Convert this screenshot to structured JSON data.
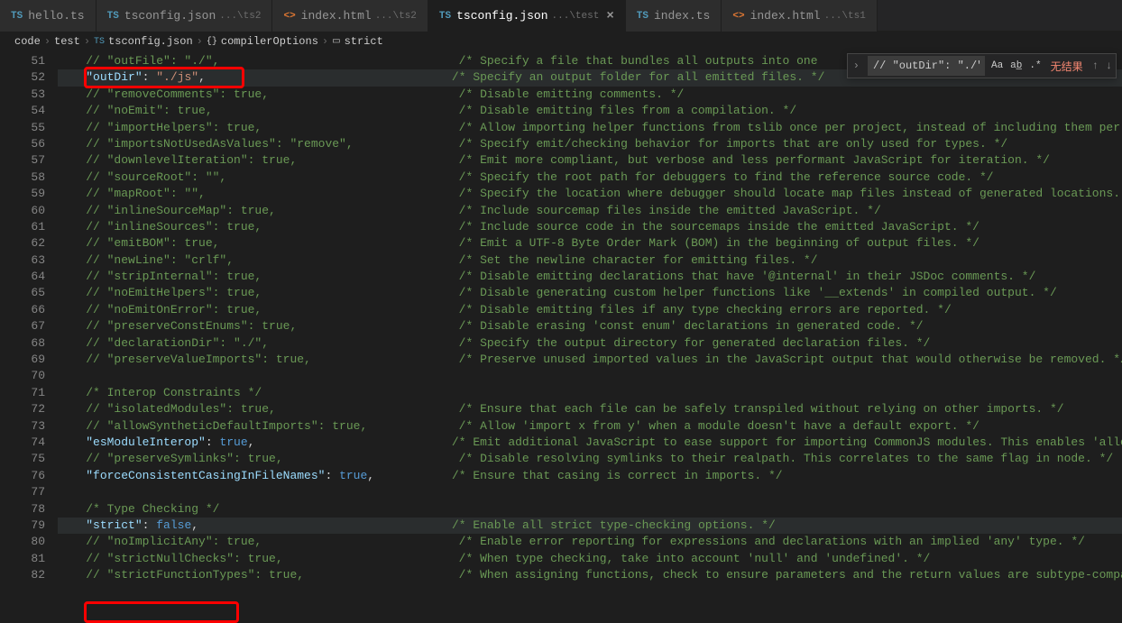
{
  "tabs": [
    {
      "icon": "TS",
      "label": "hello.ts",
      "path": "",
      "active": false
    },
    {
      "icon": "TS",
      "label": "tsconfig.json",
      "path": "...\\ts2",
      "active": false
    },
    {
      "icon": "<>",
      "label": "index.html",
      "path": "...\\ts2",
      "active": false,
      "html": true
    },
    {
      "icon": "TS",
      "label": "tsconfig.json",
      "path": "...\\test",
      "active": true,
      "close": "×"
    },
    {
      "icon": "TS",
      "label": "index.ts",
      "path": "",
      "active": false
    },
    {
      "icon": "<>",
      "label": "index.html",
      "path": "...\\ts1",
      "active": false,
      "html": true
    }
  ],
  "breadcrumb": {
    "items": [
      "code",
      "test",
      "tsconfig.json",
      "compilerOptions",
      "strict"
    ],
    "sep": "›"
  },
  "find": {
    "toggle": "›",
    "value": "// \"outDir\": \"./\",",
    "btns": {
      "aa": "Aa",
      "ab": "ab̲",
      "re": ".*"
    },
    "result": "无结果",
    "up": "↑",
    "down": "↓"
  },
  "lines": [
    {
      "n": 51,
      "c": "    // \"outFile\": \"./\",                                  /* Specify a file that bundles all outputs into one "
    },
    {
      "n": 52,
      "key": "\"outDir\"",
      "val": "\"./js\"",
      "c2": "/* Specify an output folder for all emitted files. */",
      "hi": true,
      "strval": true
    },
    {
      "n": 53,
      "c": "    // \"removeComments\": true,                           /* Disable emitting comments. */"
    },
    {
      "n": 54,
      "c": "    // \"noEmit\": true,                                   /* Disable emitting files from a compilation. */"
    },
    {
      "n": 55,
      "c": "    // \"importHelpers\": true,                            /* Allow importing helper functions from tslib once per project, instead of including them per-f"
    },
    {
      "n": 56,
      "c": "    // \"importsNotUsedAsValues\": \"remove\",               /* Specify emit/checking behavior for imports that are only used for types. */"
    },
    {
      "n": 57,
      "c": "    // \"downlevelIteration\": true,                       /* Emit more compliant, but verbose and less performant JavaScript for iteration. */"
    },
    {
      "n": 58,
      "c": "    // \"sourceRoot\": \"\",                                 /* Specify the root path for debuggers to find the reference source code. */"
    },
    {
      "n": 59,
      "c": "    // \"mapRoot\": \"\",                                    /* Specify the location where debugger should locate map files instead of generated locations. *"
    },
    {
      "n": 60,
      "c": "    // \"inlineSourceMap\": true,                          /* Include sourcemap files inside the emitted JavaScript. */"
    },
    {
      "n": 61,
      "c": "    // \"inlineSources\": true,                            /* Include source code in the sourcemaps inside the emitted JavaScript. */"
    },
    {
      "n": 62,
      "c": "    // \"emitBOM\": true,                                  /* Emit a UTF-8 Byte Order Mark (BOM) in the beginning of output files. */"
    },
    {
      "n": 63,
      "c": "    // \"newLine\": \"crlf\",                                /* Set the newline character for emitting files. */"
    },
    {
      "n": 64,
      "c": "    // \"stripInternal\": true,                            /* Disable emitting declarations that have '@internal' in their JSDoc comments. */"
    },
    {
      "n": 65,
      "c": "    // \"noEmitHelpers\": true,                            /* Disable generating custom helper functions like '__extends' in compiled output. */"
    },
    {
      "n": 66,
      "c": "    // \"noEmitOnError\": true,                            /* Disable emitting files if any type checking errors are reported. */"
    },
    {
      "n": 67,
      "c": "    // \"preserveConstEnums\": true,                       /* Disable erasing 'const enum' declarations in generated code. */"
    },
    {
      "n": 68,
      "c": "    // \"declarationDir\": \"./\",                           /* Specify the output directory for generated declaration files. */"
    },
    {
      "n": 69,
      "c": "    // \"preserveValueImports\": true,                     /* Preserve unused imported values in the JavaScript output that would otherwise be removed. */"
    },
    {
      "n": 70,
      "c": ""
    },
    {
      "n": 71,
      "c": "    /* Interop Constraints */"
    },
    {
      "n": 72,
      "c": "    // \"isolatedModules\": true,                          /* Ensure that each file can be safely transpiled without relying on other imports. */"
    },
    {
      "n": 73,
      "c": "    // \"allowSyntheticDefaultImports\": true,             /* Allow 'import x from y' when a module doesn't have a default export. */"
    },
    {
      "n": 74,
      "key": "\"esModuleInterop\"",
      "val": "true",
      "c2": "/* Emit additional JavaScript to ease support for importing CommonJS modules. This enables 'allo",
      "boolval": true
    },
    {
      "n": 75,
      "c": "    // \"preserveSymlinks\": true,                         /* Disable resolving symlinks to their realpath. This correlates to the same flag in node. */"
    },
    {
      "n": 76,
      "key": "\"forceConsistentCasingInFileNames\"",
      "val": "true",
      "c2": "/* Ensure that casing is correct in imports. */",
      "boolval": true
    },
    {
      "n": 77,
      "c": ""
    },
    {
      "n": 78,
      "c": "    /* Type Checking */"
    },
    {
      "n": 79,
      "key": "\"strict\"",
      "val": "false",
      "c2": "/* Enable all strict type-checking options. */",
      "hi": true,
      "boolval": true,
      "cursor": true
    },
    {
      "n": 80,
      "c": "    // \"noImplicitAny\": true,                            /* Enable error reporting for expressions and declarations with an implied 'any' type. */"
    },
    {
      "n": 81,
      "c": "    // \"strictNullChecks\": true,                         /* When type checking, take into account 'null' and 'undefined'. */"
    },
    {
      "n": 82,
      "c": "    // \"strictFunctionTypes\": true,                      /* When assigning functions, check to ensure parameters and the return values are subtype-compat"
    }
  ]
}
